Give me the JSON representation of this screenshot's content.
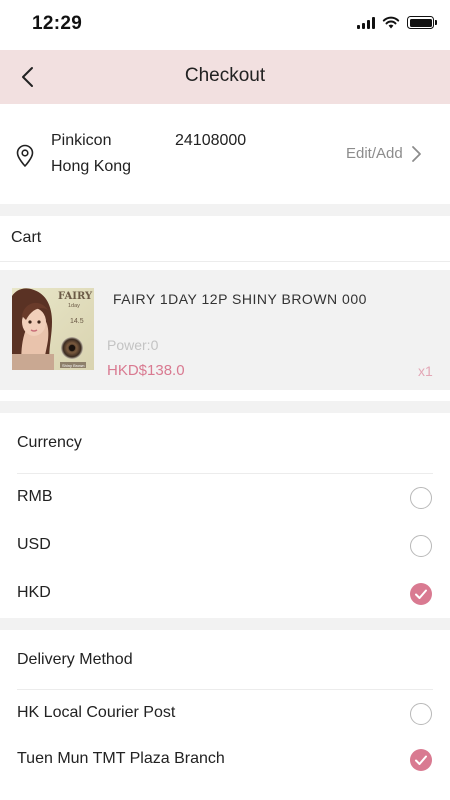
{
  "status_bar": {
    "time": "12:29"
  },
  "nav": {
    "title": "Checkout"
  },
  "address": {
    "name": "Pinkicon",
    "phone": "24108000",
    "region": "Hong Kong",
    "edit_label": "Edit/Add"
  },
  "cart": {
    "header": "Cart",
    "items": [
      {
        "name": "FAIRY 1DAY 12P SHINY BROWN 000",
        "power": "Power:0",
        "price": "HKD$138.0",
        "quantity": "x1",
        "image_text": {
          "brand": "FAIRY",
          "line": "1day",
          "diameter": "14.5",
          "color": "Shiny Brown"
        }
      }
    ]
  },
  "currency": {
    "title": "Currency",
    "selected": "HKD",
    "options": [
      {
        "label": "RMB",
        "checked": false
      },
      {
        "label": "USD",
        "checked": false
      },
      {
        "label": "HKD",
        "checked": true
      }
    ]
  },
  "delivery": {
    "title": "Delivery Method",
    "options": [
      {
        "label": "HK Local Courier Post",
        "checked": false
      },
      {
        "label": "Tuen Mun TMT Plaza Branch",
        "checked": true
      }
    ]
  },
  "colors": {
    "accent": "#d97a91",
    "nav_background": "#f2e0e0",
    "section_gap": "#f2f2f2"
  }
}
